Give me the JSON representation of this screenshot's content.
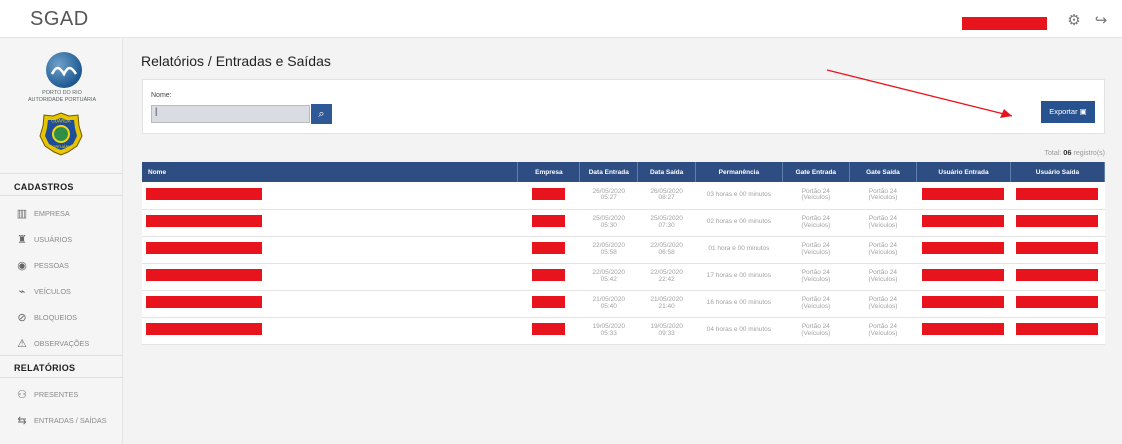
{
  "app": {
    "title": "SGAD"
  },
  "header": {
    "settings_icon": "gear-icon",
    "logout_icon": "logout-icon"
  },
  "sidebar": {
    "org_line1": "PORTO DO RIO",
    "org_line2": "AUTORIDADE PORTUÁRIA",
    "badge_top": "GUARDA",
    "badge_bottom": "PORTUÁRIA",
    "badge_sub": "BRASIL",
    "cadastros_title": "CADASTROS",
    "relatorios_title": "RELATÓRIOS",
    "items": [
      {
        "label": "EMPRESA",
        "icon": "building-icon"
      },
      {
        "label": "USUÁRIOS",
        "icon": "users-icon"
      },
      {
        "label": "PESSOAS",
        "icon": "person-icon"
      },
      {
        "label": "VEÍCULOS",
        "icon": "car-icon"
      },
      {
        "label": "BLOQUEIOS",
        "icon": "block-icon"
      },
      {
        "label": "OBSERVAÇÕES",
        "icon": "warning-icon"
      },
      {
        "label": "PRESENTES",
        "icon": "people-icon"
      },
      {
        "label": "ENTRADAS / SAÍDAS",
        "icon": "exchange-icon"
      }
    ]
  },
  "main": {
    "breadcrumb": "Relatórios / Entradas e Saídas",
    "filter": {
      "label": "Nome:",
      "value": "|",
      "search_icon": "search-icon"
    },
    "export_label": "Exportar",
    "total_label": "Total:",
    "total_count": "06",
    "total_suffix": "registro(s)",
    "table": {
      "headers": [
        "Nome",
        "Empresa",
        "Data Entrada",
        "Data Saída",
        "Permanência",
        "Gate Entrada",
        "Gate Saída",
        "Usuário Entrada",
        "Usuário Saída"
      ],
      "rows": [
        {
          "entry_date": "26/05/2020",
          "entry_time": "05:27",
          "exit_date": "26/05/2020",
          "exit_time": "08:27",
          "stay": "03 horas e 00 minutos",
          "gate_entry": "Portão 24",
          "gate_entry_type": "(Veículos)",
          "gate_exit": "Portão 24",
          "gate_exit_type": "(Veículos)"
        },
        {
          "entry_date": "25/05/2020",
          "entry_time": "05:30",
          "exit_date": "25/05/2020",
          "exit_time": "07:30",
          "stay": "02 horas e 00 minutos",
          "gate_entry": "Portão 24",
          "gate_entry_type": "(Veículos)",
          "gate_exit": "Portão 24",
          "gate_exit_type": "(Veículos)"
        },
        {
          "entry_date": "22/05/2020",
          "entry_time": "05:58",
          "exit_date": "22/05/2020",
          "exit_time": "06:58",
          "stay": "01 hora e 00 minutos",
          "gate_entry": "Portão 24",
          "gate_entry_type": "(Veículos)",
          "gate_exit": "Portão 24",
          "gate_exit_type": "(Veículos)"
        },
        {
          "entry_date": "22/05/2020",
          "entry_time": "05:42",
          "exit_date": "22/05/2020",
          "exit_time": "22:42",
          "stay": "17 horas e 00 minutos",
          "gate_entry": "Portão 24",
          "gate_entry_type": "(Veículos)",
          "gate_exit": "Portão 24",
          "gate_exit_type": "(Veículos)"
        },
        {
          "entry_date": "21/05/2020",
          "entry_time": "05:40",
          "exit_date": "21/05/2020",
          "exit_time": "21:40",
          "stay": "16 horas e 00 minutos",
          "gate_entry": "Portão 24",
          "gate_entry_type": "(Veículos)",
          "gate_exit": "Portão 24",
          "gate_exit_type": "(Veículos)"
        },
        {
          "entry_date": "19/05/2020",
          "entry_time": "05:33",
          "exit_date": "19/05/2020",
          "exit_time": "09:33",
          "stay": "04 horas e 00 minutos",
          "gate_entry": "Portão 24",
          "gate_entry_type": "(Veículos)",
          "gate_exit": "Portão 24",
          "gate_exit_type": "(Veículos)"
        }
      ]
    }
  },
  "colors": {
    "brand": "#2d4d83",
    "redaction": "#e8141d"
  }
}
